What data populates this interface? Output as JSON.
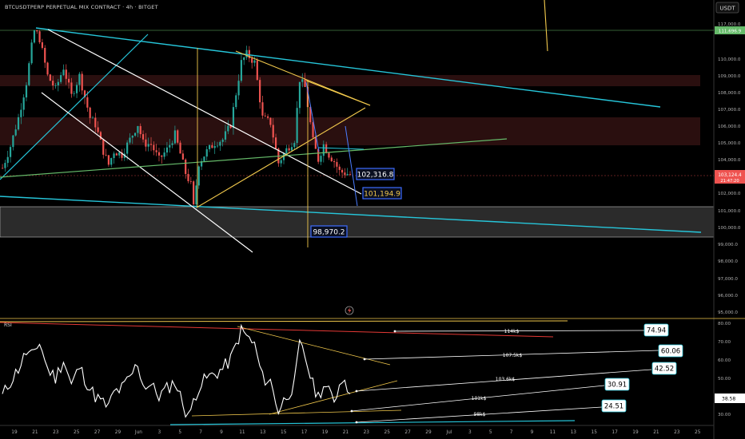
{
  "header": {
    "title": "BTCUSDTPERP PERPETUAL MIX CONTRACT · 4h · BITGET"
  },
  "currency_button": "USDT",
  "rsi_label": "RSI",
  "colors": {
    "up": "#26a69a",
    "down": "#ef5350",
    "cyan": "#26c6da",
    "yellow": "#f2c94c",
    "white": "#ffffff",
    "green_line": "#66bb6a",
    "red_line": "#e53935"
  },
  "chart_data": [
    {
      "type": "candlestick",
      "ylim": [
        94500,
        117500
      ],
      "yticks": [
        "117,000.0",
        "111,696.9",
        "110,000.0",
        "109,000.0",
        "108,000.0",
        "107,000.0",
        "106,000.0",
        "105,000.0",
        "104,000.0",
        "103,000.0",
        "102,000.0",
        "101,000.0",
        "100,000.0",
        "99,000.0",
        "98,000.0",
        "97,000.0",
        "96,000.0",
        "95,000.0"
      ],
      "ytick_values": [
        117000,
        111697,
        110000,
        109000,
        108000,
        107000,
        106000,
        105000,
        104000,
        103000,
        102000,
        101000,
        100000,
        99000,
        98000,
        97000,
        96000,
        95000
      ],
      "x_labels": [
        "19",
        "21",
        "23",
        "25",
        "27",
        "29",
        "Jun",
        "3",
        "5",
        "7",
        "9",
        "11",
        "13",
        "15",
        "17",
        "19",
        "21",
        "23",
        "25",
        "27",
        "29",
        "Jul",
        "3",
        "5",
        "7",
        "9",
        "11",
        "13",
        "15",
        "17",
        "19",
        "21",
        "23",
        "25"
      ],
      "last_price": "103,124.4",
      "countdown": "21:47:20",
      "marked_price": "111,696.9",
      "annotations": [
        "102,316.8",
        "101,194.9",
        "98,970.2"
      ],
      "ohlc_path": [
        [
          0,
          103500
        ],
        [
          3,
          104800
        ],
        [
          6,
          106500
        ],
        [
          9,
          108600
        ],
        [
          12,
          111800
        ],
        [
          14,
          111200
        ],
        [
          17,
          109000
        ],
        [
          20,
          108200
        ],
        [
          23,
          109500
        ],
        [
          26,
          107800
        ],
        [
          29,
          109000
        ],
        [
          33,
          106500
        ],
        [
          35,
          106100
        ],
        [
          38,
          104500
        ],
        [
          40,
          103700
        ],
        [
          42,
          104500
        ],
        [
          45,
          104300
        ],
        [
          48,
          105200
        ],
        [
          51,
          106100
        ],
        [
          53,
          105000
        ],
        [
          56,
          104900
        ],
        [
          59,
          104000
        ],
        [
          62,
          104600
        ],
        [
          65,
          105500
        ],
        [
          69,
          103200
        ],
        [
          71,
          102500
        ],
        [
          72,
          101200
        ],
        [
          74,
          103800
        ],
        [
          77,
          104500
        ],
        [
          80,
          105000
        ],
        [
          83,
          105200
        ],
        [
          86,
          106100
        ],
        [
          90,
          109800
        ],
        [
          92,
          110300
        ],
        [
          95,
          109800
        ],
        [
          98,
          106500
        ],
        [
          101,
          106200
        ],
        [
          104,
          103800
        ],
        [
          107,
          104600
        ],
        [
          110,
          105200
        ],
        [
          112,
          108800
        ],
        [
          114,
          108300
        ],
        [
          117,
          105100
        ],
        [
          119,
          104000
        ],
        [
          121,
          104900
        ],
        [
          123,
          104300
        ],
        [
          125,
          103900
        ],
        [
          127,
          103300
        ],
        [
          129,
          103200
        ],
        [
          131,
          103124
        ]
      ]
    },
    {
      "type": "line",
      "name": "RSI",
      "ylim": [
        25,
        82
      ],
      "yticks": [
        "80.00",
        "70.00",
        "60.00",
        "50.00",
        "40.00",
        "30.00"
      ],
      "ytick_values": [
        80,
        70,
        60,
        50,
        40,
        30
      ],
      "rsi_last": "38.58",
      "rsi_path": [
        [
          0,
          40
        ],
        [
          3,
          48
        ],
        [
          6,
          55
        ],
        [
          9,
          64
        ],
        [
          12,
          62
        ],
        [
          14,
          70
        ],
        [
          17,
          55
        ],
        [
          20,
          50
        ],
        [
          23,
          60
        ],
        [
          26,
          46
        ],
        [
          29,
          56
        ],
        [
          33,
          44
        ],
        [
          35,
          40
        ],
        [
          38,
          36
        ],
        [
          40,
          34
        ],
        [
          42,
          42
        ],
        [
          45,
          44
        ],
        [
          48,
          50
        ],
        [
          51,
          58
        ],
        [
          53,
          46
        ],
        [
          56,
          46
        ],
        [
          59,
          40
        ],
        [
          62,
          44
        ],
        [
          65,
          48
        ],
        [
          69,
          32
        ],
        [
          71,
          30
        ],
        [
          72,
          38
        ],
        [
          74,
          45
        ],
        [
          77,
          50
        ],
        [
          80,
          52
        ],
        [
          83,
          55
        ],
        [
          86,
          60
        ],
        [
          90,
          76
        ],
        [
          92,
          73
        ],
        [
          95,
          68
        ],
        [
          98,
          50
        ],
        [
          101,
          48
        ],
        [
          104,
          32
        ],
        [
          107,
          40
        ],
        [
          110,
          46
        ],
        [
          112,
          68
        ],
        [
          114,
          62
        ],
        [
          117,
          46
        ],
        [
          119,
          40
        ],
        [
          121,
          46
        ],
        [
          123,
          42
        ],
        [
          125,
          38
        ],
        [
          127,
          46
        ],
        [
          129,
          52
        ],
        [
          131,
          38
        ]
      ],
      "levels": [
        {
          "text": "114k$",
          "value": "74.94"
        },
        {
          "text": "107.5k$",
          "value": "60.06"
        },
        {
          "text": "103.6k$",
          "value": "42.52"
        },
        {
          "text": "101k$",
          "value": "30.91"
        },
        {
          "text": "98k$",
          "value": "24.51"
        }
      ]
    }
  ]
}
